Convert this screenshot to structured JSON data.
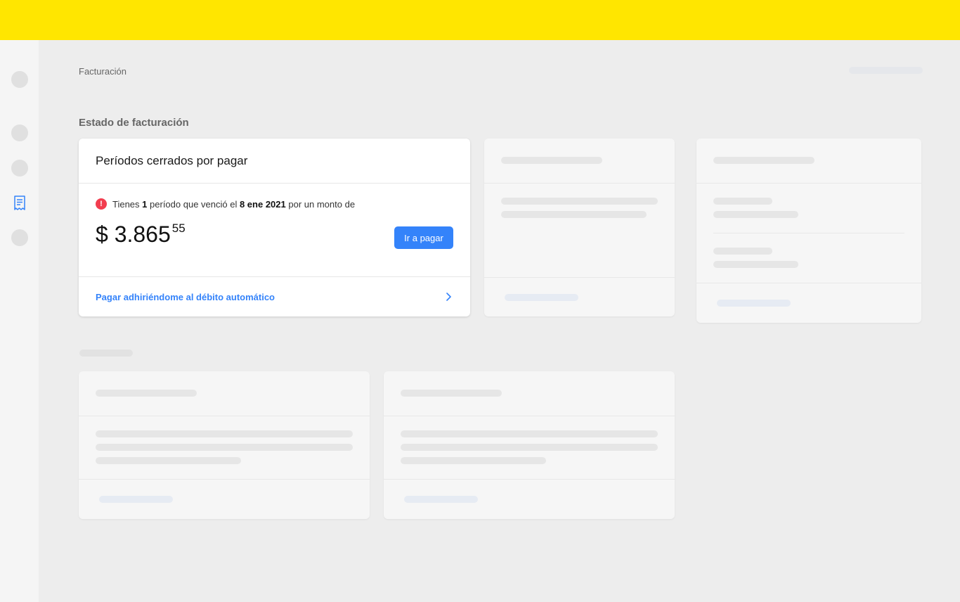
{
  "header": {
    "brand_color": "#ffe600"
  },
  "sidebar": {
    "items": [
      {
        "icon": "avatar-placeholder"
      },
      {
        "icon": "nav-placeholder"
      },
      {
        "icon": "nav-placeholder"
      },
      {
        "icon": "receipt-icon",
        "active": true
      },
      {
        "icon": "nav-placeholder"
      }
    ]
  },
  "breadcrumb": {
    "label": "Facturación"
  },
  "billing": {
    "section_title": "Estado de facturación",
    "card": {
      "title": "Períodos cerrados por pagar",
      "alert": {
        "icon": "alert-icon",
        "prefix": "Tienes",
        "count": "1",
        "middle": "período que venció el",
        "date": "8 ene 2021",
        "suffix": "por un monto de"
      },
      "amount": {
        "currency": "$",
        "integer": "3.865",
        "cents": "55"
      },
      "pay_button": "Ir a pagar",
      "auto_debit_link": "Pagar adhiriéndome al débito automático"
    }
  },
  "colors": {
    "accent": "#3483fa",
    "alert": "#f23d4f"
  }
}
